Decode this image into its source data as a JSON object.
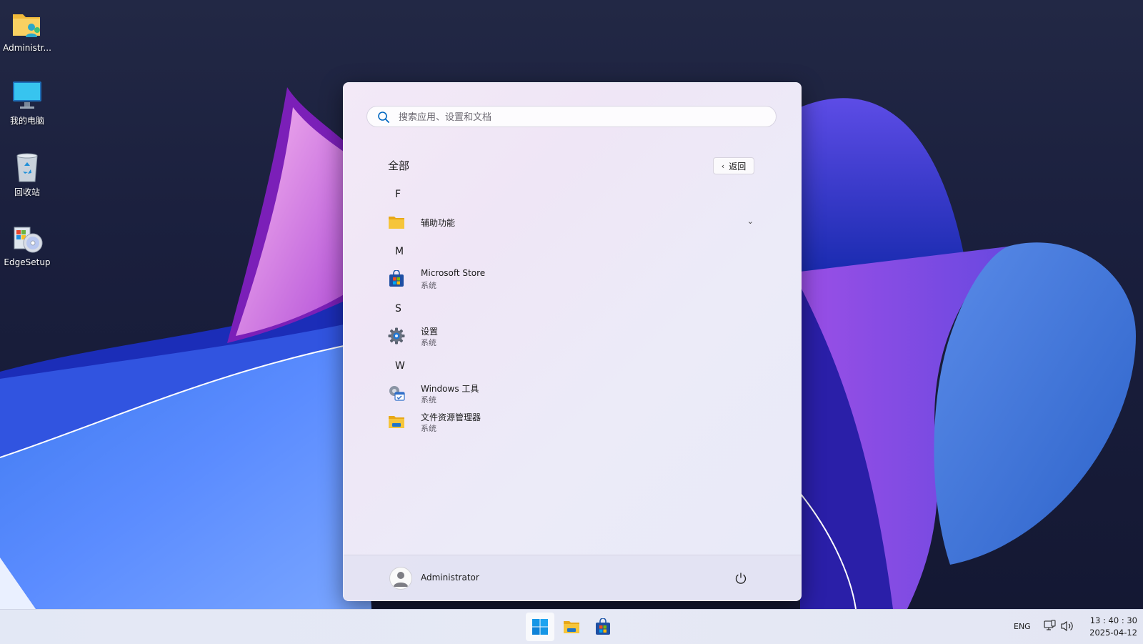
{
  "desktop": {
    "icons": [
      {
        "label": "Administr..."
      },
      {
        "label": "我的电脑"
      },
      {
        "label": "回收站"
      },
      {
        "label": "EdgeSetup"
      }
    ]
  },
  "start_menu": {
    "search": {
      "placeholder": "搜索应用、设置和文档"
    },
    "section_title": "全部",
    "back_label": "返回",
    "groups": [
      {
        "letter": "F",
        "items": [
          {
            "name": "辅助功能",
            "icon": "folder-icon",
            "expandable": true
          }
        ]
      },
      {
        "letter": "M",
        "items": [
          {
            "name": "Microsoft Store",
            "sub": "系统",
            "icon": "microsoft-store-icon"
          }
        ]
      },
      {
        "letter": "S",
        "items": [
          {
            "name": "设置",
            "sub": "系统",
            "icon": "settings-gear-icon"
          }
        ]
      },
      {
        "letter": "W",
        "items": [
          {
            "name": "Windows 工具",
            "sub": "系统",
            "icon": "windows-tools-icon"
          },
          {
            "name": "文件资源管理器",
            "sub": "系统",
            "icon": "file-explorer-icon"
          }
        ]
      }
    ],
    "footer": {
      "user_name": "Administrator"
    }
  },
  "taskbar": {
    "apps": [
      {
        "name": "start",
        "icon": "windows-start-icon",
        "active": true
      },
      {
        "name": "file-explorer",
        "icon": "file-explorer-icon"
      },
      {
        "name": "microsoft-store",
        "icon": "microsoft-store-icon"
      }
    ],
    "tray": {
      "language": "ENG",
      "time": "13 : 40 : 30",
      "date": "2025-04-12"
    }
  },
  "colors": {
    "accent": "#0067c0",
    "folder_yellow": "#f6c53b",
    "menu_bg": "#efe8f6"
  }
}
